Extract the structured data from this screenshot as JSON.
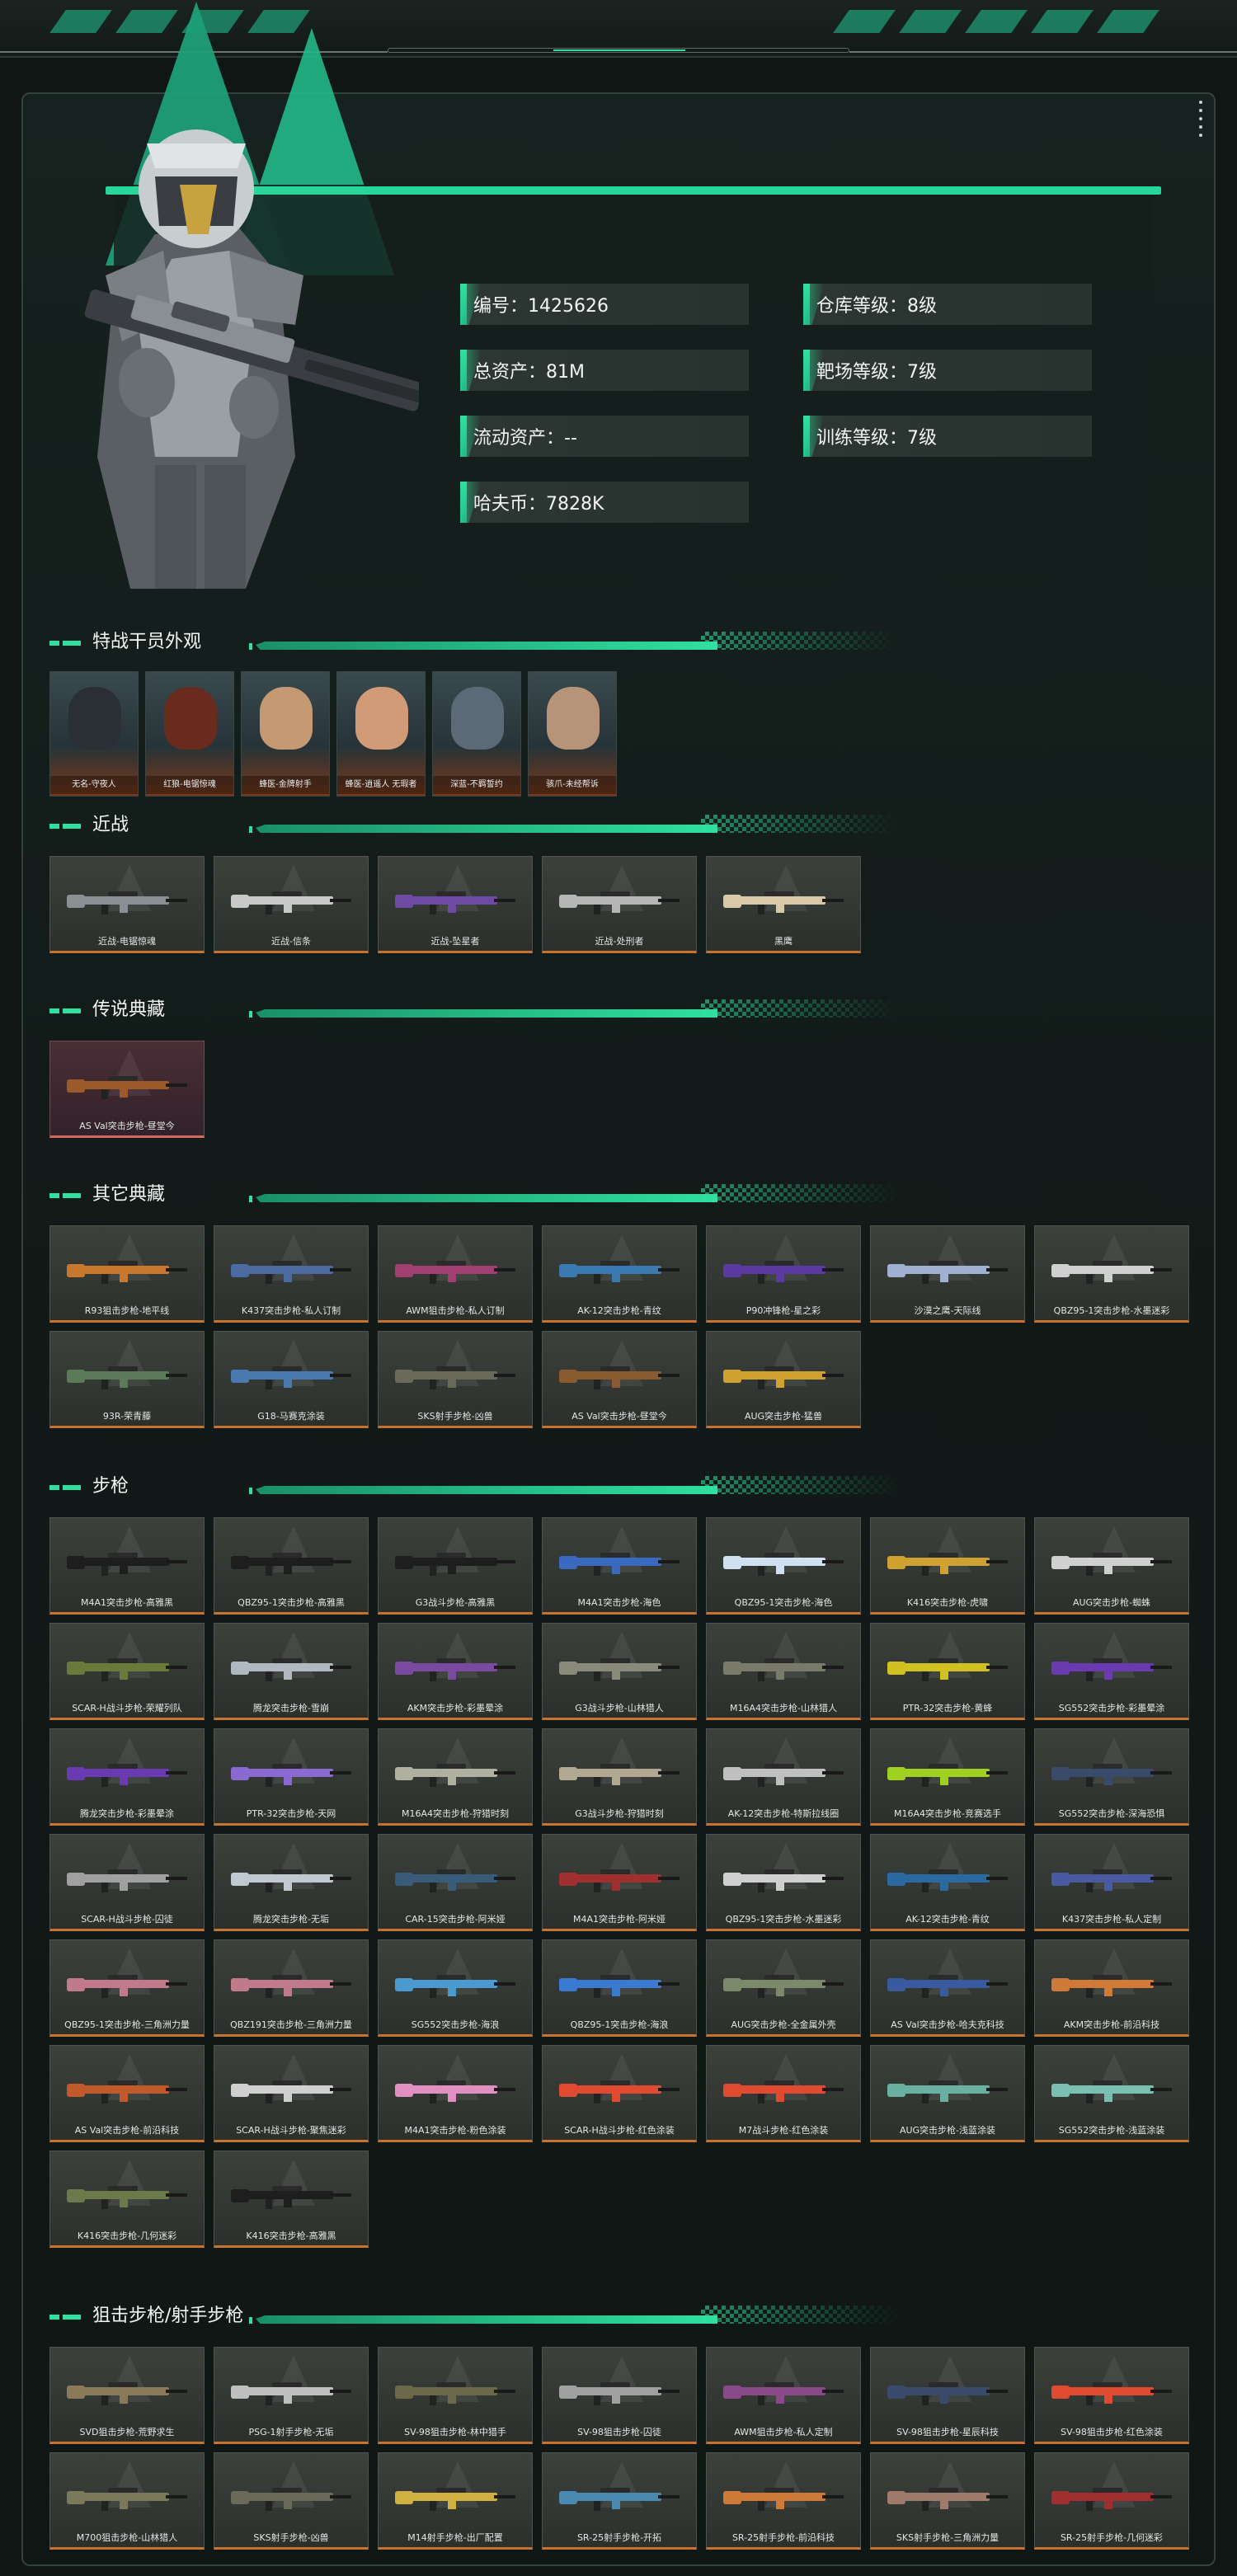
{
  "profile": {
    "stats_left": [
      {
        "label": "编号：1425626"
      },
      {
        "label": "总资产：81M"
      },
      {
        "label": "流动资产：--"
      },
      {
        "label": "哈夫币：7828K"
      }
    ],
    "stats_right": [
      {
        "label": "仓库等级：8级"
      },
      {
        "label": "靶场等级：7级"
      },
      {
        "label": "训练等级：7级"
      }
    ]
  },
  "sections": {
    "agents": {
      "title": "特战干员外观"
    },
    "melee": {
      "title": "近战"
    },
    "legend": {
      "title": "传说典藏"
    },
    "other": {
      "title": "其它典藏"
    },
    "rifle": {
      "title": "步枪"
    },
    "sniper": {
      "title": "狙击步枪/射手步枪"
    }
  },
  "agents": [
    {
      "name": "无名-守夜人",
      "color": "#2a2f33"
    },
    {
      "name": "红狼-电锯惊魂",
      "color": "#6a2a1e"
    },
    {
      "name": "蜂医-金牌射手",
      "color": "#c59a72"
    },
    {
      "name": "蜂医-逍遥人 无瑕者",
      "color": "#d29b78"
    },
    {
      "name": "深蓝-不羁誓约",
      "color": "#5c6a78"
    },
    {
      "name": "骇爪-未经帮诉",
      "color": "#b79377"
    }
  ],
  "melee": [
    {
      "name": "近战-电锯惊魂",
      "color": "#8a8f94"
    },
    {
      "name": "近战-信条",
      "color": "#c9c9c9"
    },
    {
      "name": "近战-坠星者",
      "color": "#6e4aa5"
    },
    {
      "name": "近战-处刑者",
      "color": "#b5b5b5"
    },
    {
      "name": "黑鹰",
      "color": "#d8c9a8"
    }
  ],
  "legend": [
    {
      "name": "AS Val突击步枪-昼堂今",
      "color": "#9a5a2a"
    }
  ],
  "other": [
    {
      "name": "R93狙击步枪-地平线",
      "color": "#c7782e"
    },
    {
      "name": "K437突击步枪-私人订制",
      "color": "#4a6aa0"
    },
    {
      "name": "AWM狙击步枪-私人订制",
      "color": "#a04070"
    },
    {
      "name": "AK-12突击步枪-青纹",
      "color": "#3a7ab0"
    },
    {
      "name": "P90冲锋枪-星之彩",
      "color": "#5a3aa0"
    },
    {
      "name": "沙漠之鹰-天际线",
      "color": "#a0b0d0"
    },
    {
      "name": "QBZ95-1突击步枪-水墨迷彩",
      "color": "#cfcfcf"
    },
    {
      "name": "93R-荣青藤",
      "color": "#5a7a5a"
    },
    {
      "name": "G18-马赛克涂装",
      "color": "#4a7ab0"
    },
    {
      "name": "SKS射手步枪-凶兽",
      "color": "#6a6a5a"
    },
    {
      "name": "AS Val突击步枪-昼堂今",
      "color": "#8a5a30"
    },
    {
      "name": "AUG突击步枪-猛兽",
      "color": "#d0a030"
    }
  ],
  "rifle": [
    {
      "name": "M4A1突击步枪-高雅黑",
      "color": "#1e1e1e"
    },
    {
      "name": "QBZ95-1突击步枪-高雅黑",
      "color": "#1e1e1e"
    },
    {
      "name": "G3战斗步枪-高雅黑",
      "color": "#1e1e1e"
    },
    {
      "name": "M4A1突击步枪-海色",
      "color": "#3a6ac0"
    },
    {
      "name": "QBZ95-1突击步枪-海色",
      "color": "#d0e0f0"
    },
    {
      "name": "K416突击步枪-虎啸",
      "color": "#d0a030"
    },
    {
      "name": "AUG突击步枪-蜘蛛",
      "color": "#d0d0d0"
    },
    {
      "name": "SCAR-H战斗步枪-荣耀列队",
      "color": "#6a7a3a"
    },
    {
      "name": "腾龙突击步枪-雪崩",
      "color": "#b0b8c0"
    },
    {
      "name": "AKM突击步枪-彩墨晕涂",
      "color": "#7a4aa0"
    },
    {
      "name": "G3战斗步枪-山林猎人",
      "color": "#8a8a7a"
    },
    {
      "name": "M16A4突击步枪-山林猎人",
      "color": "#7a7a6a"
    },
    {
      "name": "PTR-32突击步枪-黄蜂",
      "color": "#d0c020"
    },
    {
      "name": "SG552突击步枪-彩墨晕涂",
      "color": "#6a3ab0"
    },
    {
      "name": "腾龙突击步枪-彩墨晕涂",
      "color": "#6a3ab0"
    },
    {
      "name": "PTR-32突击步枪-天网",
      "color": "#8a6ad0"
    },
    {
      "name": "M16A4突击步枪-狩猎时刻",
      "color": "#b0b0a0"
    },
    {
      "name": "G3战斗步枪-狩猎时刻",
      "color": "#b0a890"
    },
    {
      "name": "AK-12突击步枪-特斯拉线圈",
      "color": "#c0c0c0"
    },
    {
      "name": "M16A4突击步枪-竞赛选手",
      "color": "#a0d020"
    },
    {
      "name": "SG552突击步枪-深海恐惧",
      "color": "#3a4a6a"
    },
    {
      "name": "SCAR-H战斗步枪-囚徒",
      "color": "#a0a0a0"
    },
    {
      "name": "腾龙突击步枪-无垢",
      "color": "#c0c8d0"
    },
    {
      "name": "CAR-15突击步枪-阿米娅",
      "color": "#3a5a7a"
    },
    {
      "name": "M4A1突击步枪-阿米娅",
      "color": "#a03030"
    },
    {
      "name": "QBZ95-1突击步枪-水墨迷彩",
      "color": "#d0d0d0"
    },
    {
      "name": "AK-12突击步枪-青纹",
      "color": "#2a6aa0"
    },
    {
      "name": "K437突击步枪-私人定制",
      "color": "#4a5aa0"
    },
    {
      "name": "QBZ95-1突击步枪-三角洲力量",
      "color": "#c07a8a"
    },
    {
      "name": "QBZ191突击步枪-三角洲力量",
      "color": "#c07a8a"
    },
    {
      "name": "SG552突击步枪-海浪",
      "color": "#4a9ad0"
    },
    {
      "name": "QBZ95-1突击步枪-海浪",
      "color": "#3a7ad0"
    },
    {
      "name": "AUG突击步枪-全金属外壳",
      "color": "#7a8a6a"
    },
    {
      "name": "AS Val突击步枪-哈夫克科技",
      "color": "#3a5aa0"
    },
    {
      "name": "AKM突击步枪-前沿科技",
      "color": "#d07a3a"
    },
    {
      "name": "AS Val突击步枪-前沿科技",
      "color": "#c05a2a"
    },
    {
      "name": "SCAR-H战斗步枪-聚焦迷彩",
      "color": "#d0d0d0"
    },
    {
      "name": "M4A1突击步枪-粉色涂装",
      "color": "#e090c0"
    },
    {
      "name": "SCAR-H战斗步枪-红色涂装",
      "color": "#e04a30"
    },
    {
      "name": "M7战斗步枪-红色涂装",
      "color": "#e04a30"
    },
    {
      "name": "AUG突击步枪-浅蓝涂装",
      "color": "#6ab0a0"
    },
    {
      "name": "SG552突击步枪-浅蓝涂装",
      "color": "#7ac0b0"
    },
    {
      "name": "K416突击步枪-几何迷彩",
      "color": "#6a7a4a"
    },
    {
      "name": "K416突击步枪-高雅黑",
      "color": "#1e1e1e"
    }
  ],
  "sniper": [
    {
      "name": "SVD狙击步枪-荒野求生",
      "color": "#8a7a5a"
    },
    {
      "name": "PSG-1射手步枪-无垢",
      "color": "#c0c0c0"
    },
    {
      "name": "SV-98狙击步枪-林中猎手",
      "color": "#6a6a4a"
    },
    {
      "name": "SV-98狙击步枪-囚徒",
      "color": "#a0a0a0"
    },
    {
      "name": "AWM狙击步枪-私人定制",
      "color": "#8a4a8a"
    },
    {
      "name": "SV-98狙击步枪-星辰科技",
      "color": "#3a4a6a"
    },
    {
      "name": "SV-98狙击步枪-红色涂装",
      "color": "#e04a30"
    },
    {
      "name": "M700狙击步枪-山林猎人",
      "color": "#7a7a5a"
    },
    {
      "name": "SKS射手步枪-凶兽",
      "color": "#6a6a5a"
    },
    {
      "name": "M14射手步枪-出厂配置",
      "color": "#d0b040"
    },
    {
      "name": "SR-25射手步枪-开拓",
      "color": "#4a8ab0"
    },
    {
      "name": "SR-25射手步枪-前沿科技",
      "color": "#d07a3a"
    },
    {
      "name": "SKS射手步枪-三角洲力量",
      "color": "#a07a6a"
    },
    {
      "name": "SR-25射手步枪-几何迷彩",
      "color": "#a03030"
    }
  ]
}
